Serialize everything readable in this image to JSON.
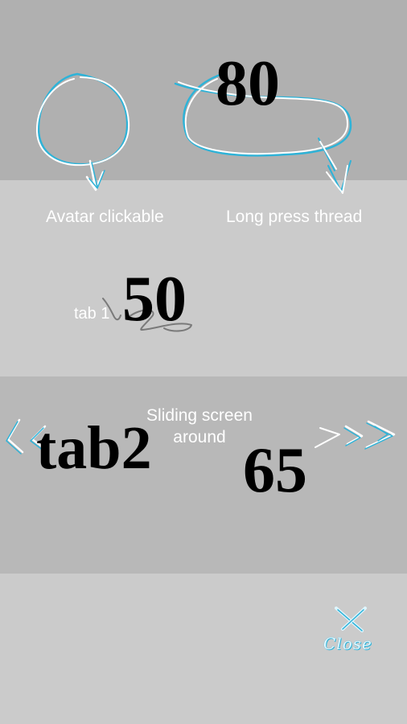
{
  "sections": {
    "top": {
      "value": "80"
    },
    "gestures": {
      "avatar_label": "Avatar clickable",
      "long_press_label": "Long press thread",
      "tab1_label": "tab 1",
      "value": "50"
    },
    "sliding": {
      "label": "Sliding screen around",
      "tab2_label": "tab2",
      "value": "65"
    },
    "bottom": {
      "close_label": "Close"
    }
  },
  "colors": {
    "stroke_white": "#ffffff",
    "stroke_blue": "#2eb3d8",
    "stroke_gray": "#7a7a7a",
    "band_1": "#b0b0b0",
    "band_2": "#cbcbcb",
    "band_3": "#b8b8b8",
    "band_4": "#cbcbcb"
  },
  "icons": {
    "avatar_gesture": "circle-with-down-arrow-icon",
    "long_press_gesture": "oval-with-down-arrow-icon",
    "tab1_gesture": "scribble-icon",
    "swipe_left": "double-chevron-left-icon",
    "swipe_right": "double-chevron-right-icon",
    "close": "x-icon"
  }
}
